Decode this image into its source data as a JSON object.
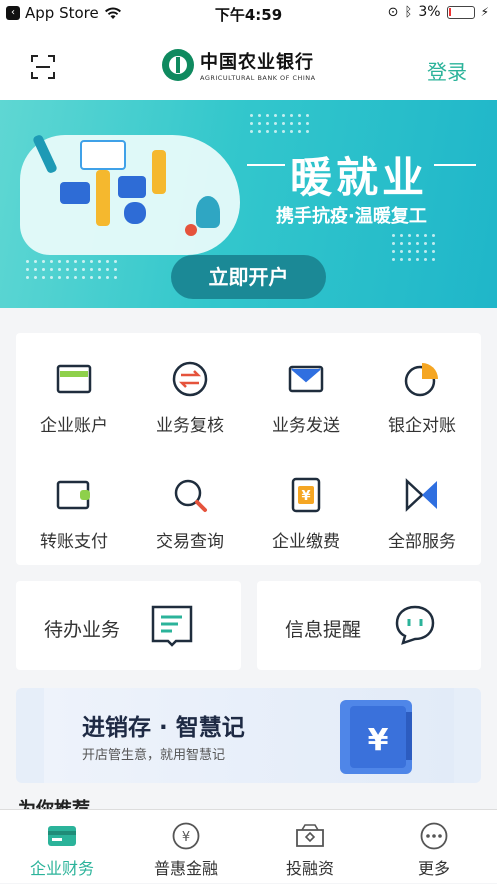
{
  "status_bar": {
    "back_app": "App Store",
    "time": "下午4:59",
    "battery": "3%"
  },
  "header": {
    "logo_cn": "中国农业银行",
    "logo_en": "AGRICULTURAL BANK OF CHINA",
    "login_label": "登录"
  },
  "banner": {
    "title": "暖就业",
    "subtitle": "携手抗疫·温暖复工",
    "cta": "立即开户"
  },
  "services": [
    {
      "label": "企业账户",
      "icon": "card-icon"
    },
    {
      "label": "业务复核",
      "icon": "exchange-icon"
    },
    {
      "label": "业务发送",
      "icon": "mail-icon"
    },
    {
      "label": "银企对账",
      "icon": "pie-icon"
    },
    {
      "label": "转账支付",
      "icon": "wallet-icon"
    },
    {
      "label": "交易查询",
      "icon": "search-icon"
    },
    {
      "label": "企业缴费",
      "icon": "yuan-receipt-icon"
    },
    {
      "label": "全部服务",
      "icon": "bowtie-icon"
    }
  ],
  "quick": {
    "todo_label": "待办业务",
    "reminder_label": "信息提醒"
  },
  "promo": {
    "title": "进销存 · 智慧记",
    "subtitle": "开店管生意，就用智慧记"
  },
  "section_peek": "为你推荐",
  "tabs": [
    {
      "label": "企业财务",
      "icon": "finance-card-icon",
      "active": true
    },
    {
      "label": "普惠金融",
      "icon": "yuan-circle-icon",
      "active": false
    },
    {
      "label": "投融资",
      "icon": "investment-icon",
      "active": false
    },
    {
      "label": "更多",
      "icon": "more-dots-icon",
      "active": false
    }
  ],
  "colors": {
    "accent": "#2bb39a",
    "brand_green": "#0f8a5f",
    "banner_start": "#5fd7d3",
    "banner_end": "#1fb6c9",
    "cta_bg": "#1b8996",
    "orange": "#f5a623",
    "icon_dark": "#1f2d3d",
    "red": "#e5533c",
    "blue": "#2f6fe0"
  }
}
